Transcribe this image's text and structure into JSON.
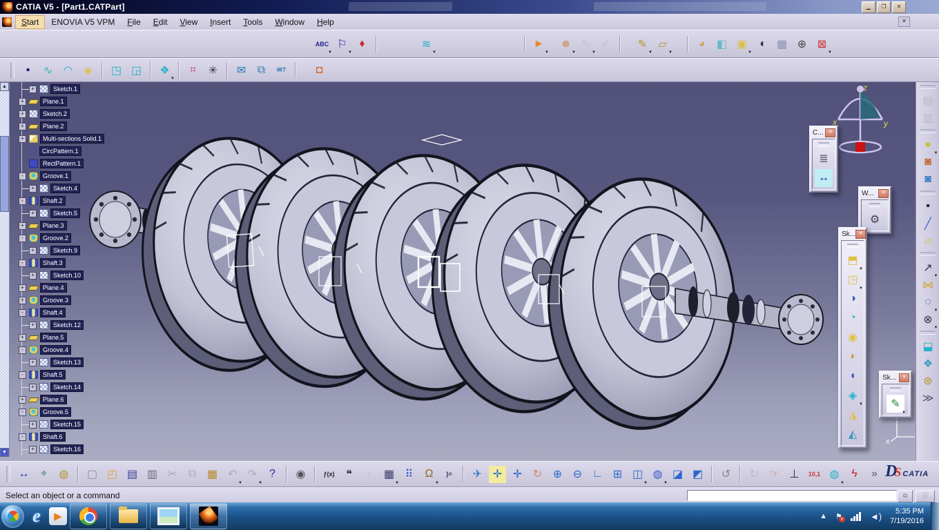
{
  "window": {
    "title": "CATIA V5 - [Part1.CATPart]"
  },
  "glyphs": {
    "close": "✕",
    "minimize": "▁",
    "restore": "❐",
    "dropdown": "▼",
    "up": "▲",
    "down": "▼",
    "chevrons": "≫"
  },
  "menu": {
    "items": [
      {
        "label": "Start",
        "u": 0,
        "hl": true
      },
      {
        "label": "ENOVIA V5 VPM",
        "u": -1
      },
      {
        "label": "File",
        "u": 0
      },
      {
        "label": "Edit",
        "u": 0
      },
      {
        "label": "View",
        "u": 0
      },
      {
        "label": "Insert",
        "u": 0
      },
      {
        "label": "Tools",
        "u": 0
      },
      {
        "label": "Window",
        "u": 0
      },
      {
        "label": "Help",
        "u": 0
      }
    ]
  },
  "toolbar_top": [
    {
      "n": "text-with-leader",
      "g": "ABC",
      "fg": "#22228c",
      "dd": 1,
      "small": 1
    },
    {
      "n": "flag-note-with-leader",
      "g": "⚐",
      "fg": "#22228c",
      "dd": 1
    },
    {
      "n": "datum-target",
      "g": "♦",
      "fg": "#cc2b2b"
    },
    {
      "n": "sep"
    },
    {
      "n": "gap",
      "w": 52
    },
    {
      "n": "multi-layer-surface",
      "g": "≋",
      "fg": "#27aec2",
      "dd": 1
    },
    {
      "n": "gap",
      "w": 122
    },
    {
      "n": "sep"
    },
    {
      "n": "select-pointer",
      "g": "►",
      "fg": "#e8862a",
      "dd": 1
    },
    {
      "n": "gap",
      "w": 10
    },
    {
      "n": "selection-sets",
      "g": "☻",
      "fg": "#caa27a",
      "dd": 1
    },
    {
      "n": "faded-brush",
      "g": "✎",
      "fg": "#c4c4ce",
      "dd": 1
    },
    {
      "n": "faded-wand",
      "g": "✐",
      "fg": "#c4c4ce"
    },
    {
      "n": "sep"
    },
    {
      "n": "gap",
      "w": 12
    },
    {
      "n": "sketcher-pad",
      "g": "✎",
      "fg": "#b8932a",
      "dd": 1
    },
    {
      "n": "sketch-reuse",
      "g": "▱",
      "fg": "#b8932a",
      "dd": 1
    },
    {
      "n": "gap",
      "w": 16
    },
    {
      "n": "sep"
    },
    {
      "n": "view-shaded",
      "g": "◕",
      "fg": "#c9a85a"
    },
    {
      "n": "view-shaded-edges",
      "g": "◧",
      "fg": "#68b8c9"
    },
    {
      "n": "view-shaded-hidden-edges",
      "g": "▣",
      "fg": "#d9c14a",
      "dd": 1
    },
    {
      "n": "view-wireframe-dark",
      "g": "◖",
      "fg": "#2b2b55"
    },
    {
      "n": "view-hidden-lines",
      "g": "▦",
      "fg": "#8890b0"
    },
    {
      "n": "view-perspective",
      "g": "⊕",
      "fg": "#444"
    },
    {
      "n": "view-xray",
      "g": "⊠",
      "fg": "#cc3333",
      "dd": 1
    }
  ],
  "toolbar_second": [
    {
      "n": "handle"
    },
    {
      "n": "point",
      "g": "▪",
      "fg": "#22226a"
    },
    {
      "n": "spline",
      "g": "∿",
      "fg": "#29b2c6"
    },
    {
      "n": "arc",
      "g": "◠",
      "fg": "#29b2c6"
    },
    {
      "n": "plane-diamond",
      "g": "◈",
      "fg": "#dfc24a"
    },
    {
      "n": "sep"
    },
    {
      "n": "select-element-a",
      "g": "◳",
      "fg": "#29b2c6"
    },
    {
      "n": "select-element-b",
      "g": "◲",
      "fg": "#29b2c6"
    },
    {
      "n": "sep"
    },
    {
      "n": "multi-output",
      "g": "❖",
      "fg": "#29b2c6",
      "dd": 1
    },
    {
      "n": "sep"
    },
    {
      "n": "grid-pick",
      "g": "⌗",
      "fg": "#c23a6a"
    },
    {
      "n": "smart-pick",
      "g": "✳",
      "fg": "#33335a"
    },
    {
      "n": "sep"
    },
    {
      "n": "mail",
      "g": "✉",
      "fg": "#2a7ab5"
    },
    {
      "n": "mail-multiple",
      "g": "⧉",
      "fg": "#2a7ab5"
    },
    {
      "n": "mail-help",
      "g": "✉?",
      "fg": "#2a7ab5",
      "small": 1
    },
    {
      "n": "sep"
    },
    {
      "n": "gap",
      "w": 14
    },
    {
      "n": "vpm-connection",
      "g": "◘",
      "fg": "#d4692a"
    }
  ],
  "toolbar_bottom": [
    {
      "n": "handle"
    },
    {
      "n": "measure-between",
      "g": "↔",
      "fg": "#2233aa"
    },
    {
      "n": "measure-item",
      "g": "⌖",
      "fg": "#3a8a6a"
    },
    {
      "n": "measure-inertia",
      "g": "◍",
      "fg": "#b8932a"
    },
    {
      "n": "sep"
    },
    {
      "n": "new-document",
      "g": "▢",
      "fg": "#8a8aa0"
    },
    {
      "n": "open-document",
      "g": "◰",
      "fg": "#dca540"
    },
    {
      "n": "save",
      "g": "▤",
      "fg": "#3a3a99"
    },
    {
      "n": "print",
      "g": "▥",
      "fg": "#6a6a80"
    },
    {
      "n": "cut",
      "g": "✂",
      "fg": "#a9a9b9"
    },
    {
      "n": "copy",
      "g": "⧉",
      "fg": "#a9a9b9"
    },
    {
      "n": "paste",
      "g": "▦",
      "fg": "#b58a2a"
    },
    {
      "n": "undo",
      "g": "↶",
      "fg": "#a9a9b9",
      "dd": 1
    },
    {
      "n": "redo",
      "g": "↷",
      "fg": "#a9a9b9",
      "dd": 1
    },
    {
      "n": "whats-this",
      "g": "?",
      "fg": "#2a2a99"
    },
    {
      "n": "sep"
    },
    {
      "n": "capture-camera",
      "g": "◉",
      "fg": "#555"
    },
    {
      "n": "sep"
    },
    {
      "n": "formula-fx",
      "g": "ƒ(x)",
      "fg": "#222",
      "small": 1
    },
    {
      "n": "comment",
      "g": "❝",
      "fg": "#333"
    },
    {
      "n": "faded-latch",
      "g": "8",
      "fg": "#c9c9d2",
      "small": 1
    },
    {
      "n": "design-table",
      "g": "▦",
      "fg": "#3a3a6a",
      "dd": 1
    },
    {
      "n": "knowledge-inspector",
      "g": "⠿",
      "fg": "#3355cc"
    },
    {
      "n": "lock",
      "g": "Ω",
      "fg": "#8a6a20",
      "dd": 1
    },
    {
      "n": "check-analysis",
      "g": "}=",
      "fg": "#333355",
      "small": 1
    },
    {
      "n": "sep"
    },
    {
      "n": "fly-mode",
      "g": "✈",
      "fg": "#3a7ac0"
    },
    {
      "n": "fit-all-in",
      "g": "✛",
      "fg": "#2a66cc",
      "bg": "#f1ec9e"
    },
    {
      "n": "pan",
      "g": "✛",
      "fg": "#2a66cc"
    },
    {
      "n": "rotate",
      "g": "↻",
      "fg": "#c98a5a"
    },
    {
      "n": "zoom-in",
      "g": "⊕",
      "fg": "#2a66cc"
    },
    {
      "n": "zoom-out",
      "g": "⊖",
      "fg": "#2a66cc"
    },
    {
      "n": "normal-view",
      "g": "∟",
      "fg": "#2a66cc"
    },
    {
      "n": "multi-view",
      "g": "⊞",
      "fg": "#2a66cc"
    },
    {
      "n": "iso-view",
      "g": "◫",
      "fg": "#2a66cc",
      "dd": 1
    },
    {
      "n": "shading-mode",
      "g": "◍",
      "fg": "#3a5acc",
      "dd": 1
    },
    {
      "n": "hide-show",
      "g": "◪",
      "fg": "#2a66cc"
    },
    {
      "n": "swap-visible-space",
      "g": "◩",
      "fg": "#2a66cc"
    },
    {
      "n": "sep"
    },
    {
      "n": "turntable-mode",
      "g": "↺",
      "fg": "#888"
    },
    {
      "n": "sep"
    },
    {
      "n": "update-faded",
      "g": "↻",
      "fg": "#bbbbc8"
    },
    {
      "n": "manipulation",
      "g": "☞",
      "fg": "#c98a5a"
    },
    {
      "n": "axis-system",
      "g": "⊥",
      "fg": "#333"
    },
    {
      "n": "units-decimal",
      "g": "10,1",
      "fg": "#cc3333",
      "small": 1
    },
    {
      "n": "part-body",
      "g": "◍",
      "fg": "#29b2c6",
      "dd": 1
    },
    {
      "n": "power-copy",
      "g": "ϟ",
      "fg": "#cc2222"
    },
    {
      "n": "more-tools",
      "g": "»",
      "fg": "#555577"
    }
  ],
  "toolbar_right": [
    {
      "n": "handle"
    },
    {
      "n": "catalog-a",
      "g": "▤",
      "fg": "#b9b9c6"
    },
    {
      "n": "catalog-b",
      "g": "▥",
      "fg": "#b9b9c6"
    },
    {
      "n": "handle"
    },
    {
      "n": "apply-material-sphere",
      "g": "●",
      "fg": "#cdbe3a",
      "dd": 1
    },
    {
      "n": "material-render-a",
      "g": "◙",
      "fg": "#c0662a"
    },
    {
      "n": "material-render-b",
      "g": "◙",
      "fg": "#3a7ac0"
    },
    {
      "n": "handle"
    },
    {
      "n": "point-tool",
      "g": "▪",
      "fg": "#222233"
    },
    {
      "n": "line-tool",
      "g": "╱",
      "fg": "#3366cc"
    },
    {
      "n": "plane-tool",
      "g": "▱",
      "fg": "#dfc24a"
    },
    {
      "n": "handle"
    },
    {
      "n": "translate",
      "g": "↗",
      "fg": "#333344",
      "dd": 1
    },
    {
      "n": "mirror",
      "g": "⋈",
      "fg": "#cfa63a"
    },
    {
      "n": "axis-to-axis",
      "g": "◌",
      "fg": "#3355cc",
      "dd": 1
    },
    {
      "n": "scaling",
      "g": "⊗",
      "fg": "#333344",
      "dd": 1
    },
    {
      "n": "handle"
    },
    {
      "n": "thick-surface",
      "g": "⬓",
      "fg": "#29b2c6"
    },
    {
      "n": "sew-surface",
      "g": "❖",
      "fg": "#3a9ac0"
    },
    {
      "n": "close-surface",
      "g": "⊛",
      "fg": "#b8932a"
    },
    {
      "n": "more-tools",
      "g": "≫",
      "fg": "#555577"
    }
  ],
  "spec_tree": {
    "items": [
      {
        "label": "Sketch.1",
        "icon": "sketch",
        "lvl": 2,
        "exp": "+"
      },
      {
        "label": "Plane.1",
        "icon": "plane",
        "lvl": 1,
        "exp": "+"
      },
      {
        "label": "Sketch.2",
        "icon": "sketch",
        "lvl": 1,
        "exp": "+"
      },
      {
        "label": "Plane.2",
        "icon": "plane",
        "lvl": 1,
        "exp": "+"
      },
      {
        "label": "Multi-sections Solid.1",
        "icon": "msect",
        "lvl": 1,
        "exp": "+"
      },
      {
        "label": "CircPattern.1",
        "icon": "circpat",
        "lvl": 1,
        "exp": ""
      },
      {
        "label": "RectPattern.1",
        "icon": "rectpat",
        "lvl": 1,
        "exp": ""
      },
      {
        "label": "Groove.1",
        "icon": "groove",
        "lvl": 1,
        "exp": "-"
      },
      {
        "label": "Sketch.4",
        "icon": "sketch",
        "lvl": 2,
        "exp": "+"
      },
      {
        "label": "Shaft.2",
        "icon": "shaft",
        "lvl": 1,
        "exp": "-"
      },
      {
        "label": "Sketch.5",
        "icon": "sketch",
        "lvl": 2,
        "exp": "+"
      },
      {
        "label": "Plane.3",
        "icon": "plane",
        "lvl": 1,
        "exp": "+"
      },
      {
        "label": "Groove.2",
        "icon": "groove",
        "lvl": 1,
        "exp": "-"
      },
      {
        "label": "Sketch.9",
        "icon": "sketch",
        "lvl": 2,
        "exp": "+"
      },
      {
        "label": "Shaft.3",
        "icon": "shaft",
        "lvl": 1,
        "exp": "-"
      },
      {
        "label": "Sketch.10",
        "icon": "sketch",
        "lvl": 2,
        "exp": "+"
      },
      {
        "label": "Plane.4",
        "icon": "plane",
        "lvl": 1,
        "exp": "+"
      },
      {
        "label": "Groove.3",
        "icon": "groove",
        "lvl": 1,
        "exp": "+"
      },
      {
        "label": "Shaft.4",
        "icon": "shaft",
        "lvl": 1,
        "exp": "-"
      },
      {
        "label": "Sketch.12",
        "icon": "sketch",
        "lvl": 2,
        "exp": "+"
      },
      {
        "label": "Plane.5",
        "icon": "plane",
        "lvl": 1,
        "exp": "+"
      },
      {
        "label": "Groove.4",
        "icon": "groove",
        "lvl": 1,
        "exp": "-"
      },
      {
        "label": "Sketch.13",
        "icon": "sketch",
        "lvl": 2,
        "exp": "+"
      },
      {
        "label": "Shaft.5",
        "icon": "shaft",
        "lvl": 1,
        "exp": "-"
      },
      {
        "label": "Sketch.14",
        "icon": "sketch",
        "lvl": 2,
        "exp": "+"
      },
      {
        "label": "Plane.6",
        "icon": "plane",
        "lvl": 1,
        "exp": "+"
      },
      {
        "label": "Groove.5",
        "icon": "groove",
        "lvl": 1,
        "exp": "-"
      },
      {
        "label": "Sketch.15",
        "icon": "sketch",
        "lvl": 2,
        "exp": "+"
      },
      {
        "label": "Shaft.6",
        "icon": "shaft",
        "lvl": 1,
        "exp": "-"
      },
      {
        "label": "Sketch.16",
        "icon": "sketch",
        "lvl": 2,
        "exp": "+"
      }
    ]
  },
  "panels": {
    "constraints": {
      "title": "C...",
      "icons": [
        {
          "n": "constraints-in-dialog",
          "g": "≣",
          "fg": "#666677"
        },
        {
          "n": "constraint",
          "g": "↔",
          "fg": "#2a2a99",
          "bg": "#bfeef5"
        }
      ]
    },
    "tools_w": {
      "title": "W...",
      "icons": [
        {
          "n": "update-gear",
          "g": "⚙",
          "fg": "#444455"
        }
      ]
    },
    "sketch_features": {
      "title": "Sk...",
      "icons": [
        {
          "n": "pad",
          "g": "⬒",
          "fg": "#dfc24a",
          "dd": 1
        },
        {
          "n": "pocket",
          "g": "◳",
          "fg": "#dfc24a",
          "dd": 1
        },
        {
          "n": "shaft",
          "g": "◑",
          "fg": "#3a5ac0"
        },
        {
          "n": "groove",
          "g": "◔",
          "fg": "#29b2c6"
        },
        {
          "n": "hole",
          "g": "◉",
          "fg": "#dfc24a"
        },
        {
          "n": "rib",
          "g": "◗",
          "fg": "#c9a227"
        },
        {
          "n": "slot",
          "g": "◖",
          "fg": "#3a5ac0"
        },
        {
          "n": "multi-sections-solid",
          "g": "◈",
          "fg": "#29b2c6",
          "dd": 1
        },
        {
          "n": "stiffener",
          "g": "◮",
          "fg": "#dfc24a"
        },
        {
          "n": "removed-multi-sections",
          "g": "◭",
          "fg": "#3a9ac0"
        }
      ]
    },
    "sketcher": {
      "title": "Sk...",
      "icons": [
        {
          "n": "sketch",
          "g": "✎",
          "fg": "#2a8a3a",
          "bg": "#ffffff",
          "dd": 1
        }
      ]
    }
  },
  "compass": {
    "z": "z",
    "x": "x",
    "y": "y"
  },
  "axis_indicator": {
    "z": "z",
    "x": "x",
    "y": "y"
  },
  "status_bar": {
    "message": "Select an object or a command",
    "command_value": "",
    "command_placeholder": ""
  },
  "taskbar": {
    "apps": [
      {
        "kind": "start",
        "name": "start-button"
      },
      {
        "kind": "ie",
        "name": "internet-explorer",
        "glyph": "e"
      },
      {
        "kind": "wmp",
        "name": "windows-media-player",
        "glyph": "▶"
      },
      {
        "kind": "chrome",
        "name": "google-chrome",
        "open": 1
      },
      {
        "kind": "folder",
        "name": "file-explorer",
        "open": 1
      },
      {
        "kind": "photo",
        "name": "photo-viewer",
        "open": 1
      },
      {
        "kind": "catia",
        "name": "catia-app",
        "open": 1,
        "active": 1
      }
    ],
    "tray": {
      "hidden_icons": "▲",
      "action_center_x": "✕"
    },
    "time": "5:35 PM",
    "date": "7/19/2016"
  },
  "logo": {
    "d": "D",
    "s": "S",
    "name": "CATIA"
  },
  "colors": {
    "viewport_top": "#515179",
    "viewport_bottom": "#abacc4",
    "toolbar": "#cfccdf",
    "tree_label_bg": "#232356",
    "taskbar_blue": "#1b5086"
  }
}
